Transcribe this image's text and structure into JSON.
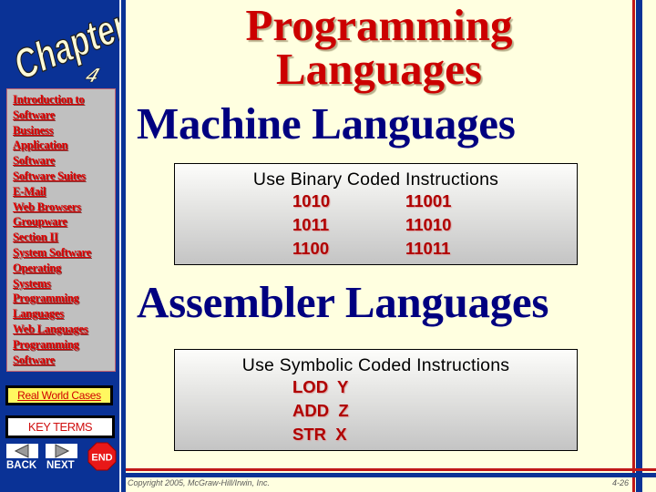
{
  "sidebar": {
    "logo": {
      "word": "Chapter",
      "number": "4"
    },
    "nav_links": [
      "Introduction to",
      "Software",
      "Business",
      "Application",
      "Software",
      "Software Suites",
      "E-Mail",
      "Web Browsers",
      "Groupware",
      "Section II",
      "System Software",
      "Operating",
      "Systems",
      "Programming",
      "Languages",
      "Web Languages",
      "Programming",
      "Software"
    ],
    "real_world_cases_label": "Real World Cases",
    "key_terms_label": "KEY TERMS",
    "back_label": "BACK",
    "next_label": "NEXT",
    "end_label": "END",
    "icons": {
      "back": "left-triangle-arrow-icon",
      "next": "right-triangle-arrow-icon",
      "end": "stop-sign-icon"
    }
  },
  "slide": {
    "title_line1": "Programming",
    "title_line2": "Languages",
    "machine": {
      "heading": "Machine Languages",
      "box_title": "Use Binary Coded Instructions",
      "column_a": [
        "1010",
        "1011",
        "1100"
      ],
      "column_b": [
        "11001",
        "11010",
        "11011"
      ]
    },
    "assembler": {
      "heading": "Assembler Languages",
      "box_title": "Use Symbolic Coded Instructions",
      "instructions": [
        "LOD  Y",
        "ADD  Z",
        "STR  X"
      ]
    }
  },
  "footer": {
    "copyright": "Copyright 2005, McGraw-Hill/Irwin, Inc.",
    "page_number": "4-26"
  },
  "colors": {
    "sidebar_blue": "#0a3296",
    "frame_red": "#c01818",
    "background_cream": "#ffffe0",
    "title_red": "#cc0000",
    "heading_navy": "#000080",
    "code_red": "#b00000",
    "nav_panel_gray": "#c0c0c0"
  }
}
